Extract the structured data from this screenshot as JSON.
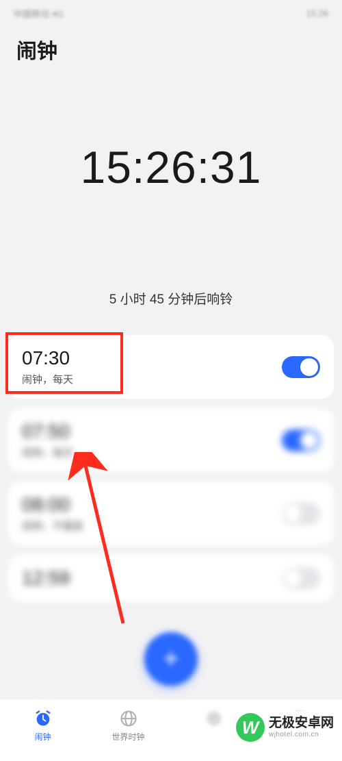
{
  "status_bar": {
    "left": "中国移动 4G",
    "right": "15:26"
  },
  "page_title": "闹钟",
  "current_time": "15:26:31",
  "next_ring_text": "5 小时 45 分钟后响铃",
  "alarms": [
    {
      "time": "07:30",
      "label": "闹钟，每天",
      "enabled": true,
      "blurred": false,
      "highlighted": true
    },
    {
      "time": "07:50",
      "label": "闹钟，每天",
      "enabled": true,
      "blurred": true,
      "highlighted": false
    },
    {
      "time": "08:00",
      "label": "闹钟，不重复",
      "enabled": false,
      "blurred": true,
      "highlighted": false
    },
    {
      "time": "12:59",
      "label": "",
      "enabled": false,
      "blurred": true,
      "highlighted": false
    }
  ],
  "fab_icon": "plus-icon",
  "nav": [
    {
      "label": "闹钟",
      "icon": "alarm-icon",
      "active": true,
      "blurred": false
    },
    {
      "label": "世界时钟",
      "icon": "globe-icon",
      "active": false,
      "blurred": false
    },
    {
      "label": "",
      "icon": "",
      "active": false,
      "blurred": true
    },
    {
      "label": "",
      "icon": "",
      "active": false,
      "blurred": true
    }
  ],
  "watermark": {
    "badge": "W",
    "main": "无极安卓网",
    "sub": "wjhotel.com.cn"
  }
}
